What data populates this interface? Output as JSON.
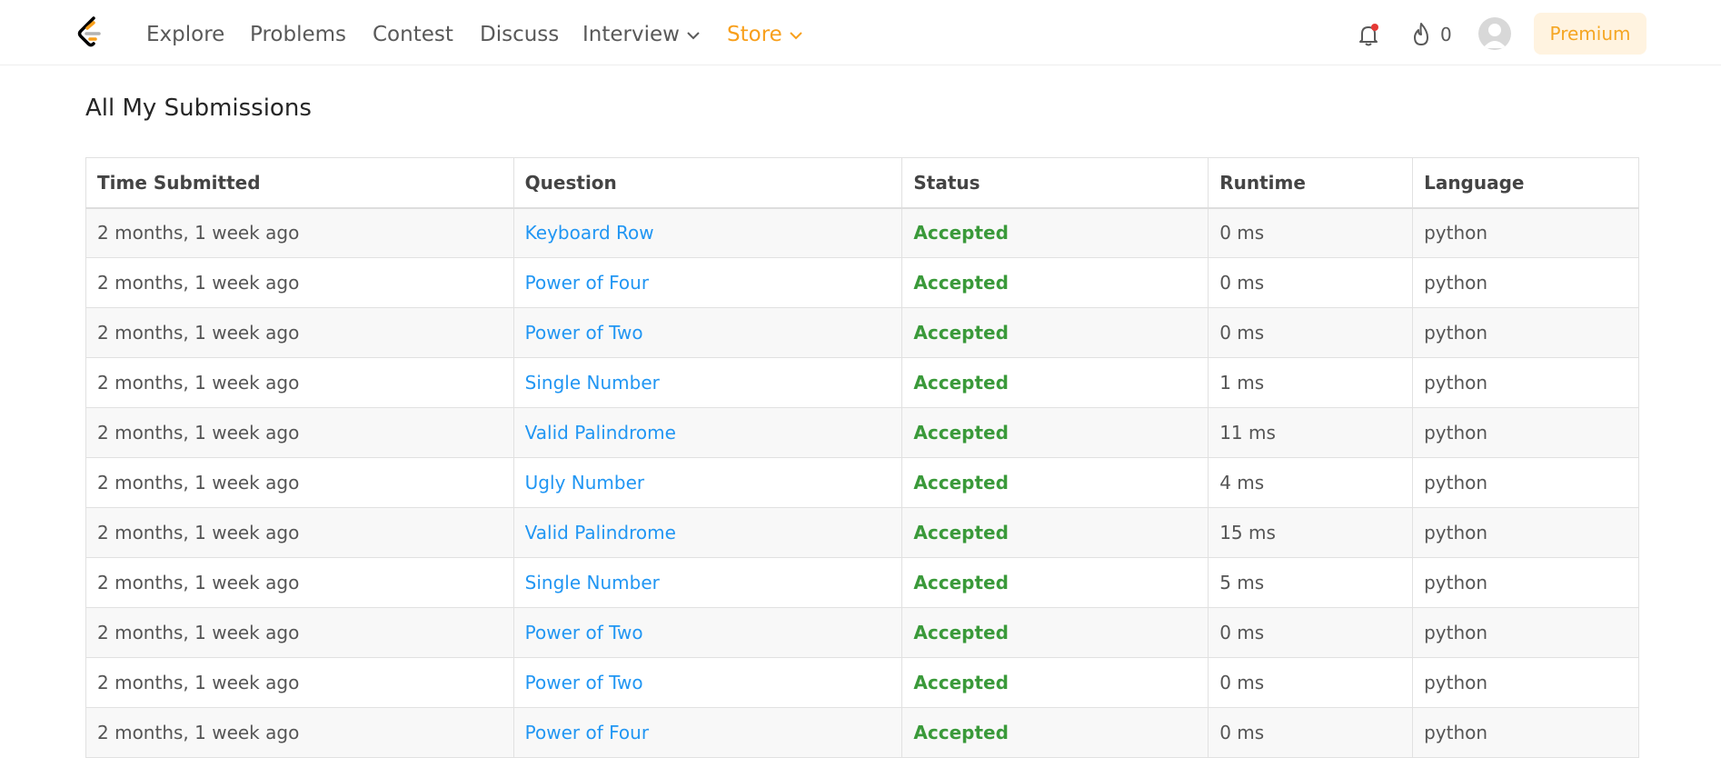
{
  "nav": {
    "links": [
      "Explore",
      "Problems",
      "Contest",
      "Discuss",
      "Interview"
    ],
    "store": "Store",
    "streak_count": "0",
    "premium": "Premium"
  },
  "page": {
    "title": "All My Submissions"
  },
  "table": {
    "headers": [
      "Time Submitted",
      "Question",
      "Status",
      "Runtime",
      "Language"
    ],
    "rows": [
      [
        "2 months, 1 week ago",
        "Keyboard Row",
        "Accepted",
        "0 ms",
        "python"
      ],
      [
        "2 months, 1 week ago",
        "Power of Four",
        "Accepted",
        "0 ms",
        "python"
      ],
      [
        "2 months, 1 week ago",
        "Power of Two",
        "Accepted",
        "0 ms",
        "python"
      ],
      [
        "2 months, 1 week ago",
        "Single Number",
        "Accepted",
        "1 ms",
        "python"
      ],
      [
        "2 months, 1 week ago",
        "Valid Palindrome",
        "Accepted",
        "11 ms",
        "python"
      ],
      [
        "2 months, 1 week ago",
        "Ugly Number",
        "Accepted",
        "4 ms",
        "python"
      ],
      [
        "2 months, 1 week ago",
        "Valid Palindrome",
        "Accepted",
        "15 ms",
        "python"
      ],
      [
        "2 months, 1 week ago",
        "Single Number",
        "Accepted",
        "5 ms",
        "python"
      ],
      [
        "2 months, 1 week ago",
        "Power of Two",
        "Accepted",
        "0 ms",
        "python"
      ],
      [
        "2 months, 1 week ago",
        "Power of Two",
        "Accepted",
        "0 ms",
        "python"
      ],
      [
        "2 months, 1 week ago",
        "Power of Four",
        "Accepted",
        "0 ms",
        "python"
      ]
    ]
  },
  "colors": {
    "accent": "#f89f1b",
    "link": "#2196f3",
    "accepted": "#3a9a3a",
    "notification_dot": "#e53935"
  }
}
